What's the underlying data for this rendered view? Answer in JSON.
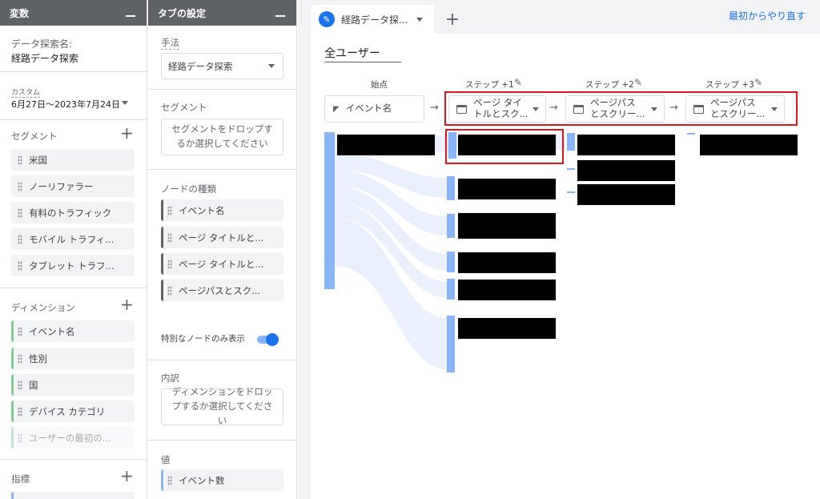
{
  "variables_panel": {
    "header": "変数",
    "exploration_name_label": "データ探索名:",
    "exploration_name": "経路データ探索",
    "date_badge": "カスタム",
    "date_range": "6月27日～2023年7月24日",
    "segments_label": "セグメント",
    "segments": [
      "米国",
      "ノーリファラー",
      "有料のトラフィック",
      "モバイル トラフィ...",
      "タブレット トラフ..."
    ],
    "dimensions_label": "ディメンション",
    "dimensions": [
      "イベント名",
      "性別",
      "国",
      "デバイス カテゴリ",
      "ユーザーの最初の..."
    ],
    "metrics_label": "指標"
  },
  "tab_settings": {
    "header": "タブの設定",
    "technique_label": "手法",
    "technique_value": "経路データ探索",
    "segment_label": "セグメント",
    "segment_drop": "セグメントをドロップするか選択してください",
    "node_type_label": "ノードの種類",
    "node_types": [
      "イベント名",
      "ページ タイトルと...",
      "ページ タイトルと...",
      "ページパスとスク..."
    ],
    "unique_nodes_label": "特別なノードのみ表示",
    "breakdown_label": "内訳",
    "breakdown_drop": "ディメンションをドロップするか選択してください",
    "values_label": "値",
    "value_item": "イベント数"
  },
  "canvas": {
    "tab_label": "経路データ探...",
    "reset_label": "最初からやり直す",
    "segment_title": "全ユーザー",
    "start_label": "始点",
    "start_node": "イベント名",
    "steps": [
      {
        "label": "ステップ +1",
        "node_line1": "ページ タイ",
        "node_line2": "トルとスク..."
      },
      {
        "label": "ステップ +2",
        "node_line1": "ページパス",
        "node_line2": "とスクリー..."
      },
      {
        "label": "ステップ +3",
        "node_line1": "ページパス",
        "node_line2": "とスクリー..."
      }
    ]
  },
  "colors": {
    "accent": "#1a73e8",
    "node_bar": "#8ab4f8",
    "highlight": "#e0141b",
    "header_bg": "#5f6368"
  },
  "icons": [
    "minimize-icon",
    "plus-icon",
    "drag-handle-icon",
    "chevron-down-icon",
    "pencil-icon",
    "arrow-right-icon",
    "cursor-icon",
    "page-icon"
  ]
}
